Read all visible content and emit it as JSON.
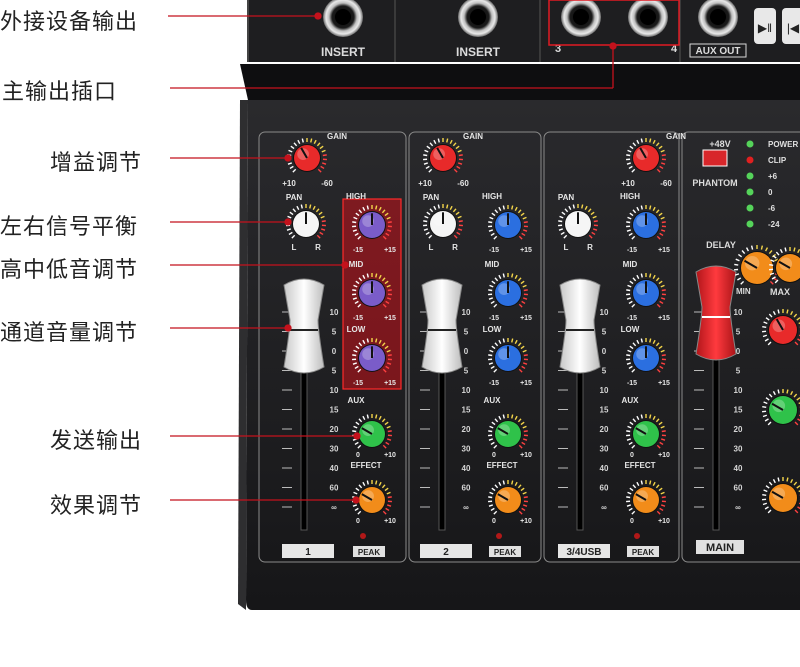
{
  "callouts": [
    "外接设备输出",
    "主输出插口",
    "增益调节",
    "左右信号平衡",
    "高中低音调节",
    "通道音量调节",
    "发送输出",
    "效果调节"
  ],
  "top_row": {
    "insert_1": "INSERT",
    "insert_2": "INSERT",
    "main_out_left": "3",
    "main_out_right": "4",
    "aux_out": "AUX OUT"
  },
  "knob_labels": {
    "gain": "GAIN",
    "gain_min": "+10",
    "gain_max": "-60",
    "pan": "PAN",
    "pan_l": "L",
    "pan_r": "R",
    "high": "HIGH",
    "mid": "MID",
    "low": "LOW",
    "eq_min": "-15",
    "eq_max": "+15",
    "aux": "AUX",
    "effect": "EFFECT",
    "send_min": "0",
    "send_max": "+10",
    "peak": "PEAK"
  },
  "fader_scale": [
    "10",
    "5",
    "0",
    "5",
    "10",
    "15",
    "20",
    "30",
    "40",
    "60",
    "∞"
  ],
  "channels": [
    "1",
    "2",
    "3/4USB"
  ],
  "master": {
    "phantom_label": "PHANTOM",
    "phantom_voltage": "+48V",
    "delay": "DELAY",
    "delay_min": "MIN",
    "max": "MAX",
    "main_label": "MAIN",
    "meter": [
      "POWER",
      "CLIP",
      "+6",
      "0",
      "-6",
      "-24"
    ]
  },
  "colors": {
    "gain_knob": "#e82a2a",
    "eq_knob_ch1": "#7a5cc9",
    "eq_knob": "#2b6fe0",
    "aux_knob": "#2fc24a",
    "effect_knob": "#f28c1a",
    "callout_line": "#c4121c",
    "main_fader": "#e8262a"
  }
}
